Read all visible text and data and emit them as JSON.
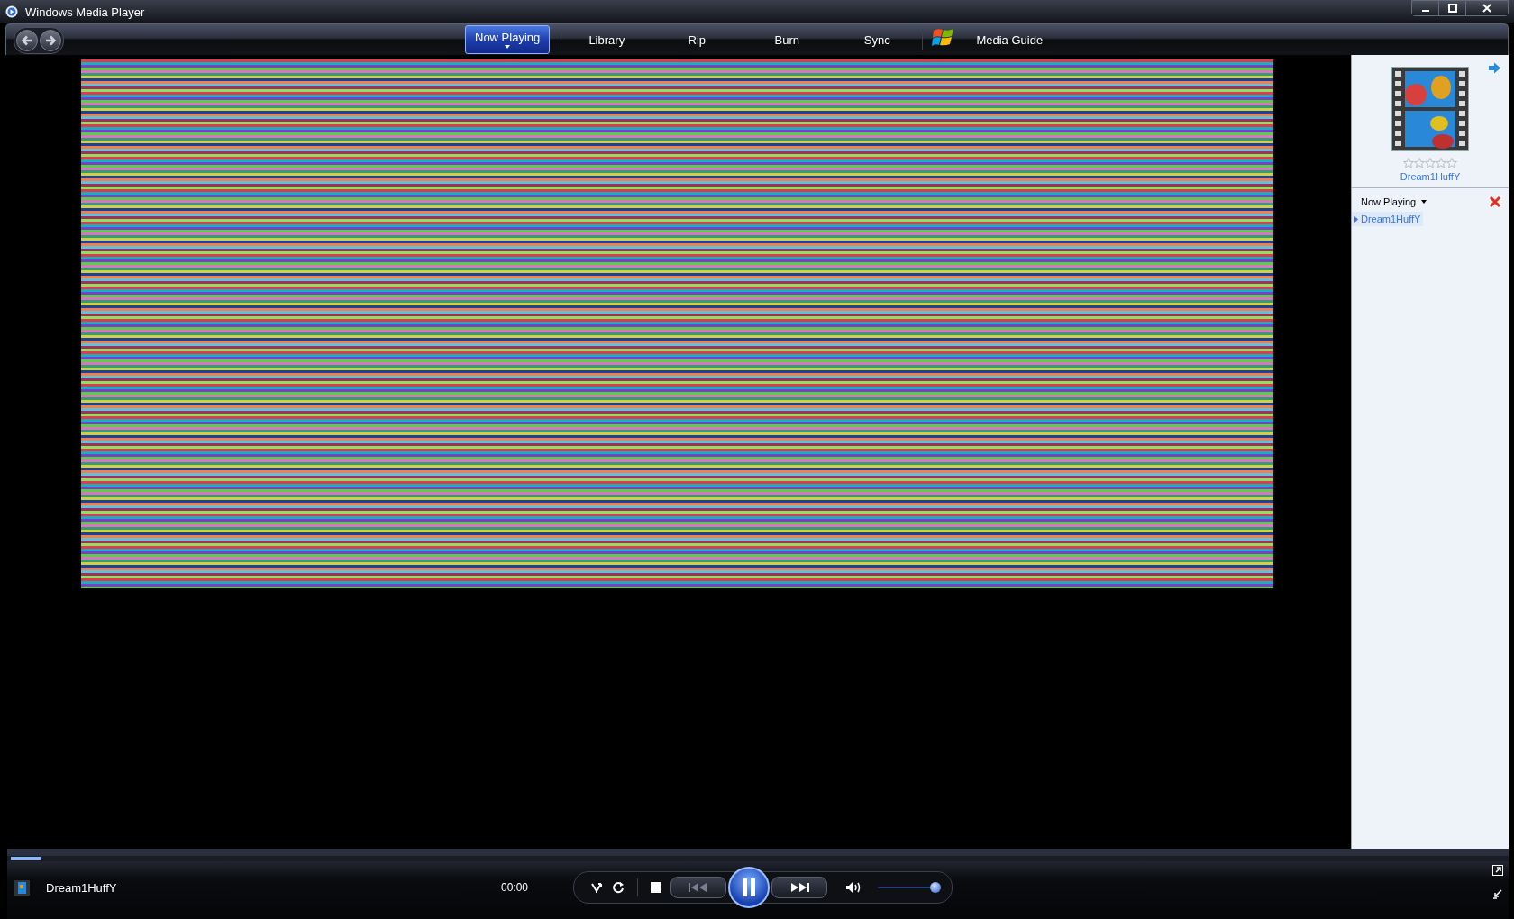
{
  "window": {
    "title": "Windows Media Player"
  },
  "tabs": [
    {
      "label": "Now Playing",
      "selected": true
    },
    {
      "label": "Library",
      "selected": false
    },
    {
      "label": "Rip",
      "selected": false
    },
    {
      "label": "Burn",
      "selected": false
    },
    {
      "label": "Sync",
      "selected": false
    },
    {
      "label": "Media Guide",
      "selected": false
    }
  ],
  "side_panel": {
    "media_title": "Dream1HuffY",
    "stars": 0,
    "list_title": "Now Playing",
    "playlist": [
      {
        "title": "Dream1HuffY",
        "selected": true
      }
    ]
  },
  "player": {
    "track": "Dream1HuffY",
    "time": "00:00",
    "playing": true,
    "seek": {
      "level": 0.02
    },
    "volume": {
      "level": 0.92
    }
  }
}
